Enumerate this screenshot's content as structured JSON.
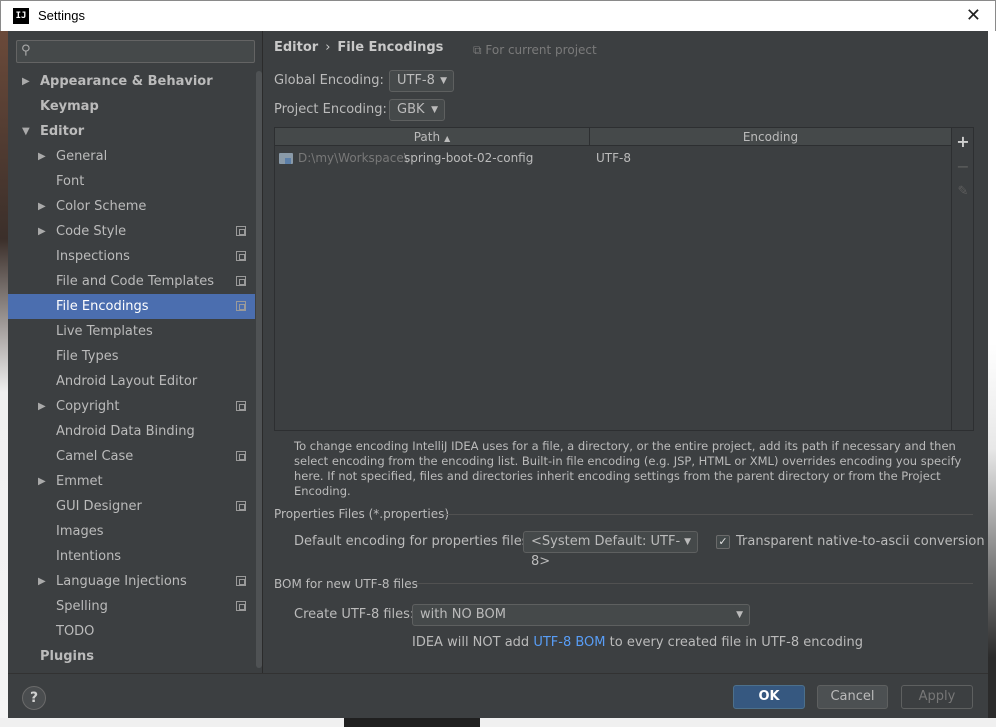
{
  "window": {
    "title": "Settings",
    "logo_text": "IJ",
    "close_glyph": "✕"
  },
  "sidebar": {
    "search_placeholder": "",
    "items": [
      {
        "label": "Appearance & Behavior",
        "level": 0,
        "expandable": true,
        "expanded": false,
        "bold": true
      },
      {
        "label": "Keymap",
        "level": 0,
        "expandable": false,
        "bold": true
      },
      {
        "label": "Editor",
        "level": 0,
        "expandable": true,
        "expanded": true,
        "bold": true
      },
      {
        "label": "General",
        "level": 1,
        "expandable": true,
        "expanded": false
      },
      {
        "label": "Font",
        "level": 1,
        "expandable": false
      },
      {
        "label": "Color Scheme",
        "level": 1,
        "expandable": true,
        "expanded": false
      },
      {
        "label": "Code Style",
        "level": 1,
        "expandable": true,
        "expanded": false,
        "project_scope": true
      },
      {
        "label": "Inspections",
        "level": 1,
        "expandable": false,
        "project_scope": true
      },
      {
        "label": "File and Code Templates",
        "level": 1,
        "expandable": false,
        "project_scope": true
      },
      {
        "label": "File Encodings",
        "level": 1,
        "expandable": false,
        "project_scope": true,
        "selected": true
      },
      {
        "label": "Live Templates",
        "level": 1,
        "expandable": false
      },
      {
        "label": "File Types",
        "level": 1,
        "expandable": false
      },
      {
        "label": "Android Layout Editor",
        "level": 1,
        "expandable": false
      },
      {
        "label": "Copyright",
        "level": 1,
        "expandable": true,
        "expanded": false,
        "project_scope": true
      },
      {
        "label": "Android Data Binding",
        "level": 1,
        "expandable": false
      },
      {
        "label": "Camel Case",
        "level": 1,
        "expandable": false,
        "project_scope": true
      },
      {
        "label": "Emmet",
        "level": 1,
        "expandable": true,
        "expanded": false
      },
      {
        "label": "GUI Designer",
        "level": 1,
        "expandable": false,
        "project_scope": true
      },
      {
        "label": "Images",
        "level": 1,
        "expandable": false
      },
      {
        "label": "Intentions",
        "level": 1,
        "expandable": false
      },
      {
        "label": "Language Injections",
        "level": 1,
        "expandable": true,
        "expanded": false,
        "project_scope": true
      },
      {
        "label": "Spelling",
        "level": 1,
        "expandable": false,
        "project_scope": true
      },
      {
        "label": "TODO",
        "level": 1,
        "expandable": false
      },
      {
        "label": "Plugins",
        "level": 0,
        "expandable": false,
        "bold": true
      }
    ]
  },
  "main": {
    "breadcrumb": {
      "parent": "Editor",
      "separator": "›",
      "current": "File Encodings"
    },
    "for_current_project": "For current project",
    "global_encoding": {
      "label": "Global Encoding:",
      "value": "UTF-8"
    },
    "project_encoding": {
      "label": "Project Encoding:",
      "value": "GBK"
    },
    "table": {
      "columns": {
        "path": "Path",
        "encoding": "Encoding",
        "sort_glyph": "▲"
      },
      "rows": [
        {
          "path_prefix": "D:\\my\\Workspace\\",
          "path_name": "spring-boot-02-config",
          "encoding": "UTF-8"
        }
      ],
      "tools": {
        "add": "+",
        "remove": "−",
        "edit": "✎"
      }
    },
    "hint": "To change encoding IntelliJ IDEA uses for a file, a directory, or the entire project, add its path if necessary and then select encoding from the encoding list. Built-in file encoding (e.g. JSP, HTML or XML) overrides encoding you specify here. If not specified, files and directories inherit encoding settings from the parent directory or from the Project Encoding.",
    "properties": {
      "section_title": "Properties Files (*.properties)",
      "default_label": "Default encoding for properties files:",
      "default_value": "<System Default: UTF-8>",
      "transparent_label": "Transparent native-to-ascii conversion",
      "transparent_checked": true
    },
    "bom": {
      "section_title": "BOM for new UTF-8 files",
      "create_label": "Create UTF-8 files:",
      "create_value": "with NO BOM",
      "note_before": "IDEA will NOT add ",
      "note_link": "UTF-8 BOM",
      "note_after": " to every created file in UTF-8 encoding"
    }
  },
  "footer": {
    "help": "?",
    "ok": "OK",
    "cancel": "Cancel",
    "apply": "Apply"
  },
  "colors": {
    "background": "#3c3f41",
    "selection": "#4b6eaf",
    "link": "#589df6",
    "ok_button": "#365880"
  }
}
